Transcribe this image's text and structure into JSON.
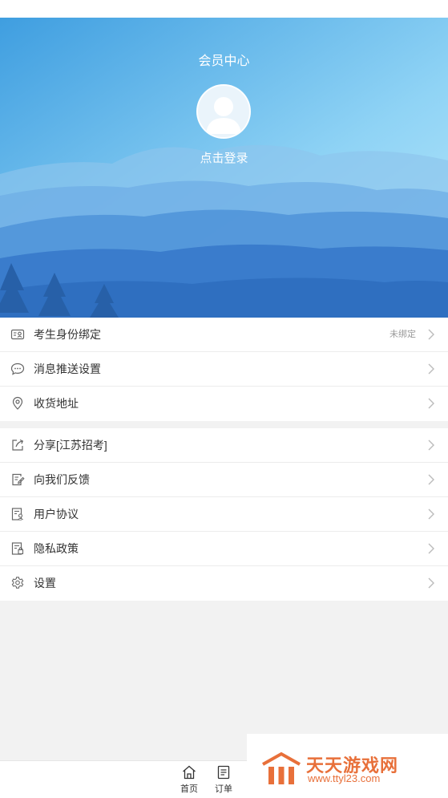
{
  "header": {
    "title": "会员中心",
    "login_label": "点击登录"
  },
  "menu_group_1": [
    {
      "label": "考生身份绑定",
      "value": "未绑定",
      "icon": "id-card-icon"
    },
    {
      "label": "消息推送设置",
      "value": "",
      "icon": "chat-bubble-icon"
    },
    {
      "label": "收货地址",
      "value": "",
      "icon": "location-pin-icon"
    }
  ],
  "menu_group_2": [
    {
      "label": "分享[江苏招考]",
      "icon": "share-icon"
    },
    {
      "label": "向我们反馈",
      "icon": "feedback-icon"
    },
    {
      "label": "用户协议",
      "icon": "agreement-icon"
    },
    {
      "label": "隐私政策",
      "icon": "privacy-icon"
    },
    {
      "label": "设置",
      "icon": "gear-icon"
    }
  ],
  "tabbar": {
    "home_label": "首页",
    "orders_label": "订单"
  },
  "watermark": {
    "cn": "天天游戏网",
    "en": "www.ttyl23.com"
  },
  "colors": {
    "hero_top": "#7dd3f5",
    "hero_bottom": "#2a6fc2",
    "accent_orange": "#e8703a"
  }
}
